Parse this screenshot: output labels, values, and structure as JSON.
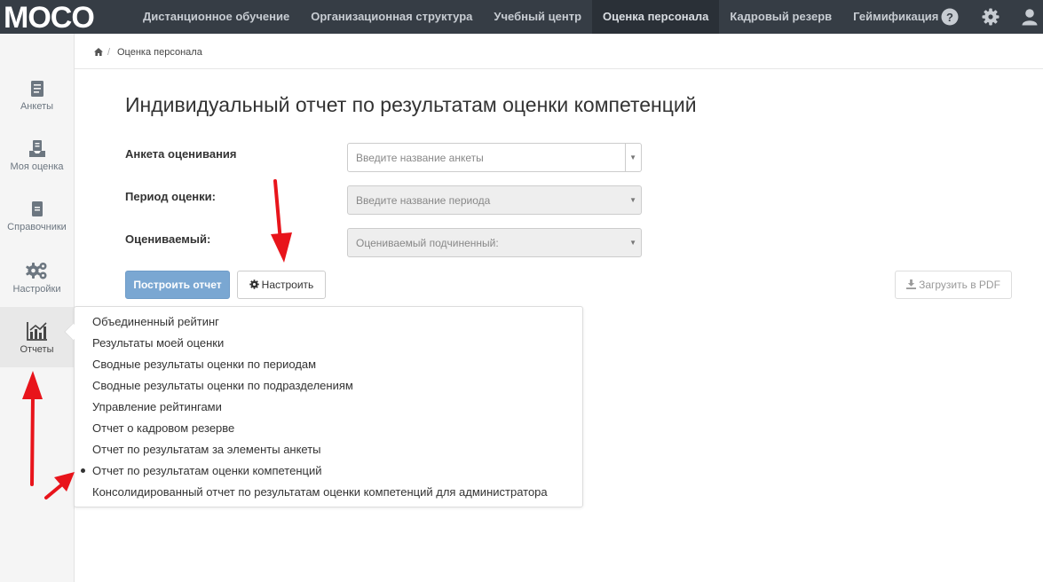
{
  "app": {
    "logo_text": "MOCO"
  },
  "nav": {
    "items": [
      "Дистанционное обучение",
      "Организационная структура",
      "Учебный центр",
      "Оценка персонала",
      "Кадровый резерв",
      "Геймификация"
    ],
    "active": "Оценка персонала",
    "icons": [
      "help-icon",
      "gear-icon",
      "user-icon"
    ]
  },
  "sidebar": {
    "items": [
      {
        "label": "Анкеты",
        "icon": "questionnaire-icon"
      },
      {
        "label": "Моя оценка",
        "icon": "my-assessment-icon"
      },
      {
        "label": "Справочники",
        "icon": "reference-book-icon"
      },
      {
        "label": "Настройки",
        "icon": "gears-icon"
      },
      {
        "label": "Отчеты",
        "icon": "chart-icon"
      }
    ],
    "active": "Отчеты"
  },
  "breadcrumb": {
    "home_icon": "home-icon",
    "current": "Оценка персонала"
  },
  "page": {
    "title": "Индивидуальный отчет по результатам оценки компетенций"
  },
  "form": {
    "survey": {
      "label": "Анкета оценивания",
      "placeholder": "Введите название анкеты"
    },
    "period": {
      "label": "Период оценки:",
      "placeholder": "Введите название периода"
    },
    "subject": {
      "label": "Оцениваемый:",
      "placeholder": "Оцениваемый подчиненный:"
    }
  },
  "buttons": {
    "build": "Построить отчет",
    "configure": "Настроить",
    "pdf": "Загрузить в PDF"
  },
  "reports_menu": {
    "items": [
      "Объединенный рейтинг",
      "Результаты моей оценки",
      "Сводные результаты оценки по периодам",
      "Сводные результаты оценки по подразделениям",
      "Управление рейтингами",
      "Отчет о кадровом резерве",
      "Отчет по результатам за элементы анкеты",
      "Отчет по результатам оценки компетенций",
      "Консолидированный отчет по результатам оценки компетенций для администратора"
    ],
    "selected": "Отчет по результатам оценки компетенций"
  },
  "colors": {
    "topbar": "#363d45",
    "primary_button": "#7aa7d2",
    "annotation_arrow": "#e8141b"
  }
}
